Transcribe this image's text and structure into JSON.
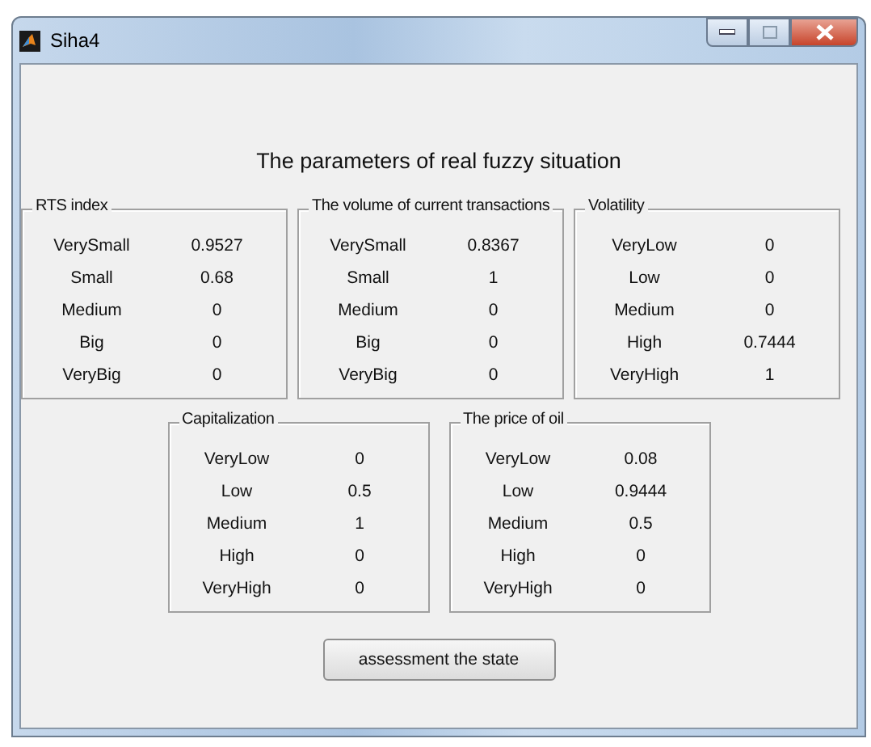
{
  "window": {
    "title": "Siha4"
  },
  "heading": "The parameters of real fuzzy situation",
  "panels": [
    {
      "title": "RTS index",
      "rows": [
        {
          "term": "VerySmall",
          "value": "0.9527"
        },
        {
          "term": "Small",
          "value": "0.68"
        },
        {
          "term": "Medium",
          "value": "0"
        },
        {
          "term": "Big",
          "value": "0"
        },
        {
          "term": "VeryBig",
          "value": "0"
        }
      ]
    },
    {
      "title": "The volume of current transactions",
      "rows": [
        {
          "term": "VerySmall",
          "value": "0.8367"
        },
        {
          "term": "Small",
          "value": "1"
        },
        {
          "term": "Medium",
          "value": "0"
        },
        {
          "term": "Big",
          "value": "0"
        },
        {
          "term": "VeryBig",
          "value": "0"
        }
      ]
    },
    {
      "title": "Volatility",
      "rows": [
        {
          "term": "VeryLow",
          "value": "0"
        },
        {
          "term": "Low",
          "value": "0"
        },
        {
          "term": "Medium",
          "value": "0"
        },
        {
          "term": "High",
          "value": "0.7444"
        },
        {
          "term": "VeryHigh",
          "value": "1"
        }
      ]
    },
    {
      "title": "Capitalization",
      "rows": [
        {
          "term": "VeryLow",
          "value": "0"
        },
        {
          "term": "Low",
          "value": "0.5"
        },
        {
          "term": "Medium",
          "value": "1"
        },
        {
          "term": "High",
          "value": "0"
        },
        {
          "term": "VeryHigh",
          "value": "0"
        }
      ]
    },
    {
      "title": "The price of oil",
      "rows": [
        {
          "term": "VeryLow",
          "value": "0.08"
        },
        {
          "term": "Low",
          "value": "0.9444"
        },
        {
          "term": "Medium",
          "value": "0.5"
        },
        {
          "term": "High",
          "value": "0"
        },
        {
          "term": "VeryHigh",
          "value": "0"
        }
      ]
    }
  ],
  "button": "assessment the state"
}
